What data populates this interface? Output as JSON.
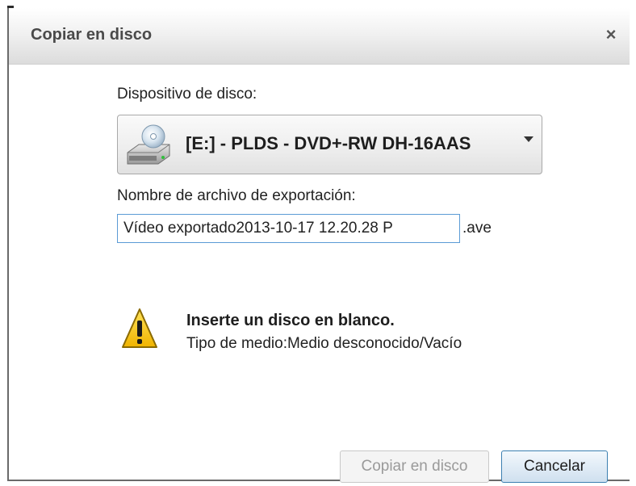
{
  "dialog": {
    "title": "Copiar en disco",
    "close_glyph": "×"
  },
  "device": {
    "label": "Dispositivo de disco:",
    "selected": "[E:] - PLDS - DVD+-RW DH-16AAS",
    "icon": "disc-drive-icon"
  },
  "export": {
    "label": "Nombre de archivo de exportación:",
    "value": "Vídeo exportado2013-10-17 12.20.28 P",
    "extension": ".ave"
  },
  "warning": {
    "icon": "warning-icon",
    "title": "Inserte un disco en blanco.",
    "message": "Tipo de medio:Medio desconocido/Vacío"
  },
  "buttons": {
    "copy_label": "Copiar en disco",
    "cancel_label": "Cancelar"
  },
  "colors": {
    "warning_yellow": "#f5c400",
    "focus_blue": "#5b9bd5"
  }
}
